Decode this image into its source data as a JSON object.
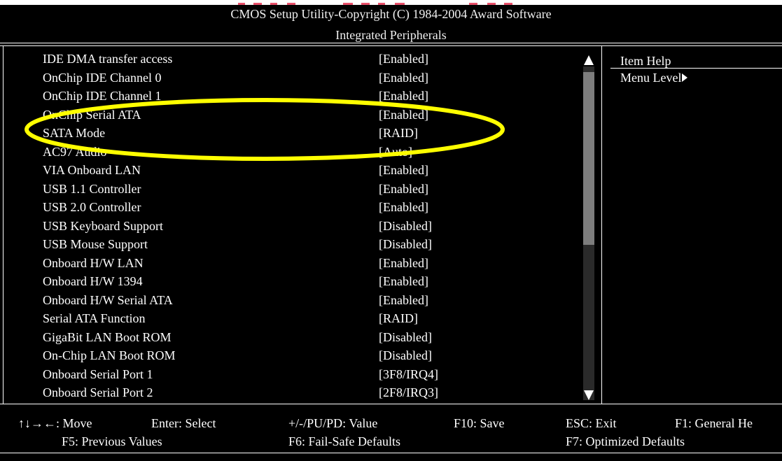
{
  "header": {
    "title": "CMOS Setup Utility-Copyright (C) 1984-2004 Award Software",
    "subtitle": "Integrated Peripherals"
  },
  "settings": [
    {
      "label": "IDE DMA transfer access",
      "value": "[Enabled]"
    },
    {
      "label": "OnChip IDE Channel 0",
      "value": "[Enabled]"
    },
    {
      "label": "OnChip IDE Channel 1",
      "value": "[Enabled]"
    },
    {
      "label": "OnChip Serial ATA",
      "value": "[Enabled]"
    },
    {
      "label": "SATA Mode",
      "value": "[RAID]"
    },
    {
      "label": "AC97 Audio",
      "value": "[Auto]"
    },
    {
      "label": "VIA Onboard LAN",
      "value": "[Enabled]"
    },
    {
      "label": "USB 1.1 Controller",
      "value": "[Enabled]"
    },
    {
      "label": "USB 2.0 Controller",
      "value": "[Enabled]"
    },
    {
      "label": "USB Keyboard Support",
      "value": "[Disabled]"
    },
    {
      "label": "USB Mouse Support",
      "value": "[Disabled]"
    },
    {
      "label": "Onboard H/W LAN",
      "value": "[Enabled]"
    },
    {
      "label": "Onboard H/W 1394",
      "value": "[Enabled]"
    },
    {
      "label": "Onboard H/W Serial ATA",
      "value": "[Enabled]"
    },
    {
      "label": "Serial ATA Function",
      "value": "[RAID]"
    },
    {
      "label": "GigaBit LAN Boot ROM",
      "value": "[Disabled]"
    },
    {
      "label": "On-Chip LAN Boot ROM",
      "value": "[Disabled]"
    },
    {
      "label": "Onboard Serial Port 1",
      "value": "[3F8/IRQ4]"
    },
    {
      "label": "Onboard Serial Port 2",
      "value": "[2F8/IRQ3]"
    }
  ],
  "help_panel": {
    "title": "Item Help",
    "menu_level": "Menu Level",
    "menu_level_icon": "right-triangle-icon"
  },
  "scrollbar": {
    "up_icon": "scroll-up-triangle-icon",
    "down_icon": "scroll-down-triangle-icon"
  },
  "annotation": {
    "highlight_color": "#ffff00",
    "highlighted_item": "SATA Mode"
  },
  "footer": {
    "move": "↑↓→←: Move",
    "enter": "Enter: Select",
    "value": "+/-/PU/PD: Value",
    "save": "F10: Save",
    "exit": "ESC: Exit",
    "help": "F1: General He",
    "previous": "F5: Previous Values",
    "failsafe": "F6: Fail-Safe Defaults",
    "optimized": "F7: Optimized Defaults"
  },
  "colors": {
    "background": "#000000",
    "text": "#ffffff",
    "scroll_track": "#2a2a2a",
    "scroll_thumb": "#7d7d7d"
  }
}
